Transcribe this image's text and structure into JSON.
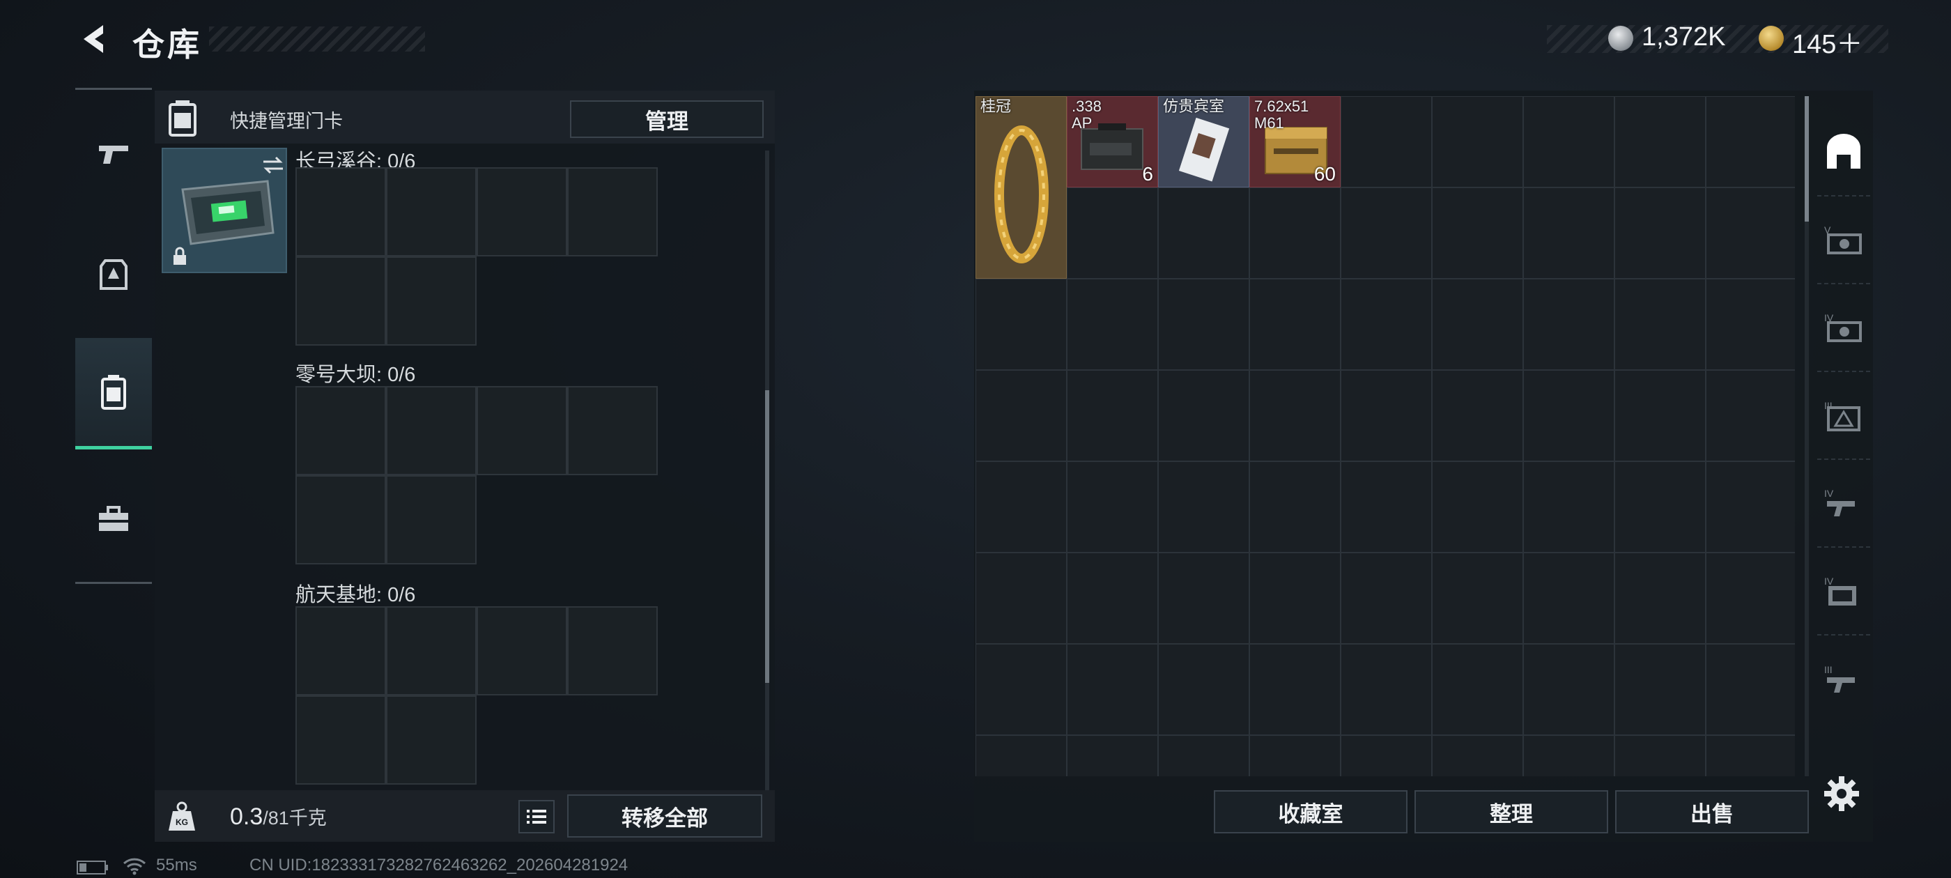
{
  "header": {
    "title": "仓库"
  },
  "currency": {
    "silver": "1,372K",
    "gold": "145＋"
  },
  "left_nav": [
    {
      "icon": "pistol-icon"
    },
    {
      "icon": "armor-icon"
    },
    {
      "icon": "keycard-icon",
      "active": true
    },
    {
      "icon": "toolbox-icon"
    }
  ],
  "keycard_panel": {
    "quick_manage_label": "快捷管理门卡",
    "manage_button": "管理",
    "maps": [
      {
        "label": "长弓溪谷: 0/6"
      },
      {
        "label": "零号大坝: 0/6"
      },
      {
        "label": "航天基地: 0/6"
      }
    ],
    "weight_value": "0.3",
    "weight_capacity": "/81千克",
    "transfer_all_button": "转移全部"
  },
  "stash": {
    "items": [
      {
        "name": "桂冠",
        "count": "",
        "bg": "#5a4a30"
      },
      {
        "name": ".338\nAP",
        "count": "6",
        "bg": "#5a2a30"
      },
      {
        "name": "仿贵宾室",
        "count": "",
        "bg": "#3e4658"
      },
      {
        "name": "7.62x51\nM61",
        "count": "60",
        "bg": "#5a2a30"
      }
    ],
    "footer_buttons": {
      "collection": "收藏室",
      "sort": "整理",
      "sell": "出售"
    }
  },
  "right_side_tabs": [
    {
      "icon": "stash-home-icon"
    },
    {
      "icon": "stash-v-icon"
    },
    {
      "icon": "stash-iv-icon"
    },
    {
      "icon": "stash-iii-icon"
    },
    {
      "icon": "stash-iv-b-icon"
    },
    {
      "icon": "stash-iv-c-icon"
    },
    {
      "icon": "stash-iii-b-icon"
    }
  ],
  "status_bar": {
    "ping": "55ms",
    "uid": "CN UID:1823331732827624632​62_202604281924"
  },
  "colors": {
    "accent": "#3fd1a0",
    "panel": "#141a1f"
  }
}
